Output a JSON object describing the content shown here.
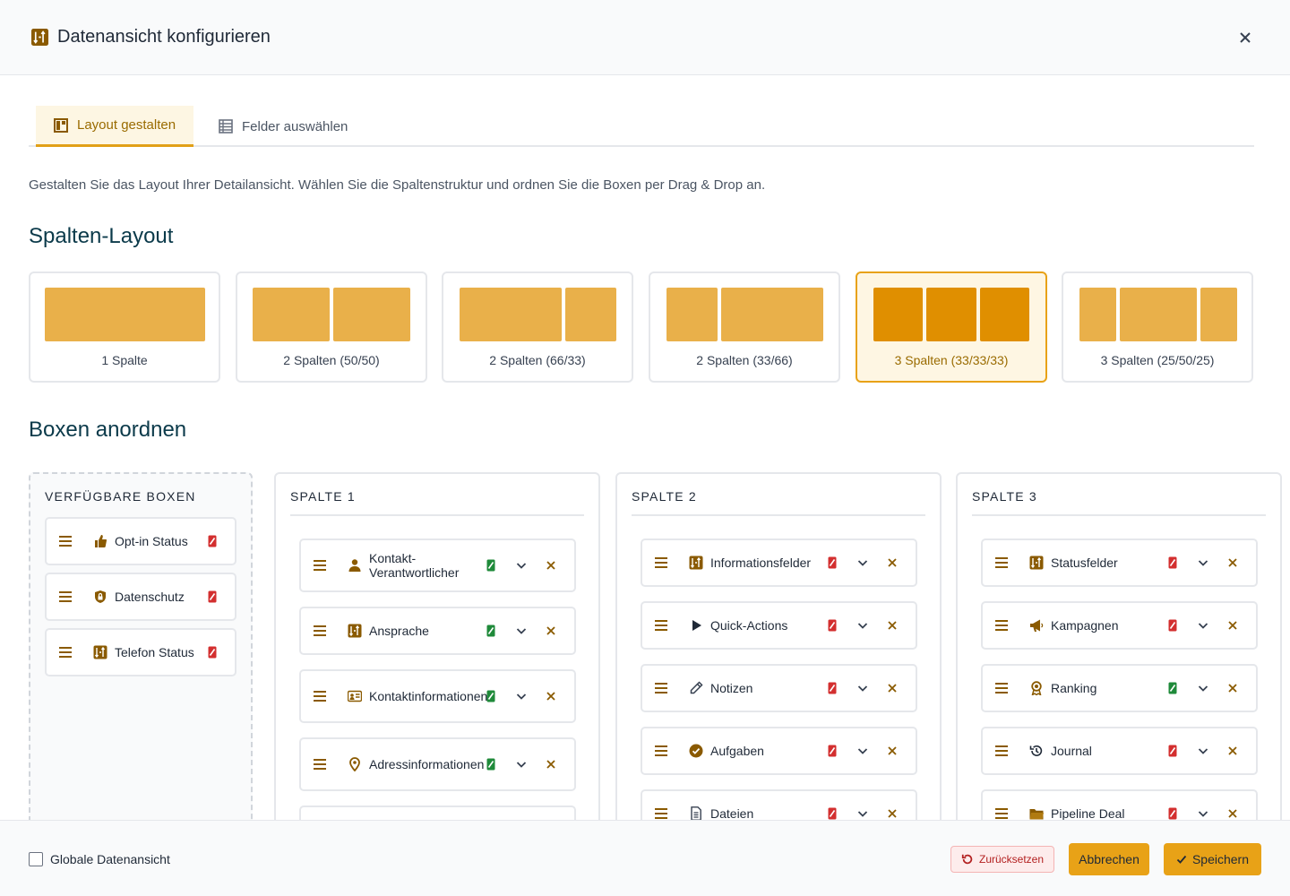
{
  "header": {
    "title": "Datenansicht konfigurieren"
  },
  "tabs": [
    {
      "label": "Layout gestalten"
    },
    {
      "label": "Felder auswählen"
    }
  ],
  "intro": "Gestalten Sie das Layout Ihrer Detailansicht. Wählen Sie die Spaltenstruktur und ordnen Sie die Boxen per Drag & Drop an.",
  "sections": {
    "layout_title": "Spalten-Layout",
    "boxes_title": "Boxen anordnen"
  },
  "layouts": [
    {
      "label": "1 Spalte"
    },
    {
      "label": "2 Spalten (50/50)"
    },
    {
      "label": "2 Spalten (66/33)"
    },
    {
      "label": "2 Spalten (33/66)"
    },
    {
      "label": "3 Spalten (33/33/33)",
      "selected": true
    },
    {
      "label": "3 Spalten (25/50/25)"
    }
  ],
  "available": {
    "heading": "VERFÜGBARE BOXEN",
    "boxes": [
      {
        "label": "Opt-in Status",
        "icon": "thumbs-up-icon",
        "mobile": "off"
      },
      {
        "label": "Datenschutz",
        "icon": "shield-lock-icon",
        "mobile": "off"
      },
      {
        "label": "Telefon Status",
        "icon": "status-icon",
        "mobile": "off"
      }
    ]
  },
  "columns": [
    {
      "heading": "SPALTE 1",
      "boxes": [
        {
          "label": "Kontakt-Verantwortlicher",
          "icon": "user-icon",
          "mobile": "on"
        },
        {
          "label": "Ansprache",
          "icon": "status-icon",
          "mobile": "on"
        },
        {
          "label": "Kontaktinformationen",
          "icon": "id-card-icon",
          "mobile": "on"
        },
        {
          "label": "Adressinformationen",
          "icon": "map-pin-icon",
          "mobile": "on"
        }
      ]
    },
    {
      "heading": "SPALTE 2",
      "boxes": [
        {
          "label": "Informationsfelder",
          "icon": "status-icon",
          "mobile": "off"
        },
        {
          "label": "Quick-Actions",
          "icon": "play-icon",
          "mobile": "off"
        },
        {
          "label": "Notizen",
          "icon": "pencil-icon",
          "mobile": "off"
        },
        {
          "label": "Aufgaben",
          "icon": "check-circle-icon",
          "mobile": "off"
        },
        {
          "label": "Dateien",
          "icon": "file-icon",
          "mobile": "off"
        }
      ]
    },
    {
      "heading": "SPALTE 3",
      "boxes": [
        {
          "label": "Statusfelder",
          "icon": "status-icon",
          "mobile": "off"
        },
        {
          "label": "Kampagnen",
          "icon": "megaphone-icon",
          "mobile": "off"
        },
        {
          "label": "Ranking",
          "icon": "award-icon",
          "mobile": "on"
        },
        {
          "label": "Journal",
          "icon": "history-icon",
          "mobile": "off"
        },
        {
          "label": "Pipeline Deal",
          "icon": "folder-icon",
          "mobile": "off"
        }
      ]
    }
  ],
  "footer": {
    "global_label": "Globale Datenansicht",
    "reset_label": "Zurücksetzen",
    "cancel_label": "Abbrechen",
    "save_label": "Speichern"
  },
  "colors": {
    "accent": "#e8a217",
    "accent_dark": "#8a5a00",
    "mobile_on": "#1f8a3a",
    "mobile_off": "#d32f2f"
  }
}
